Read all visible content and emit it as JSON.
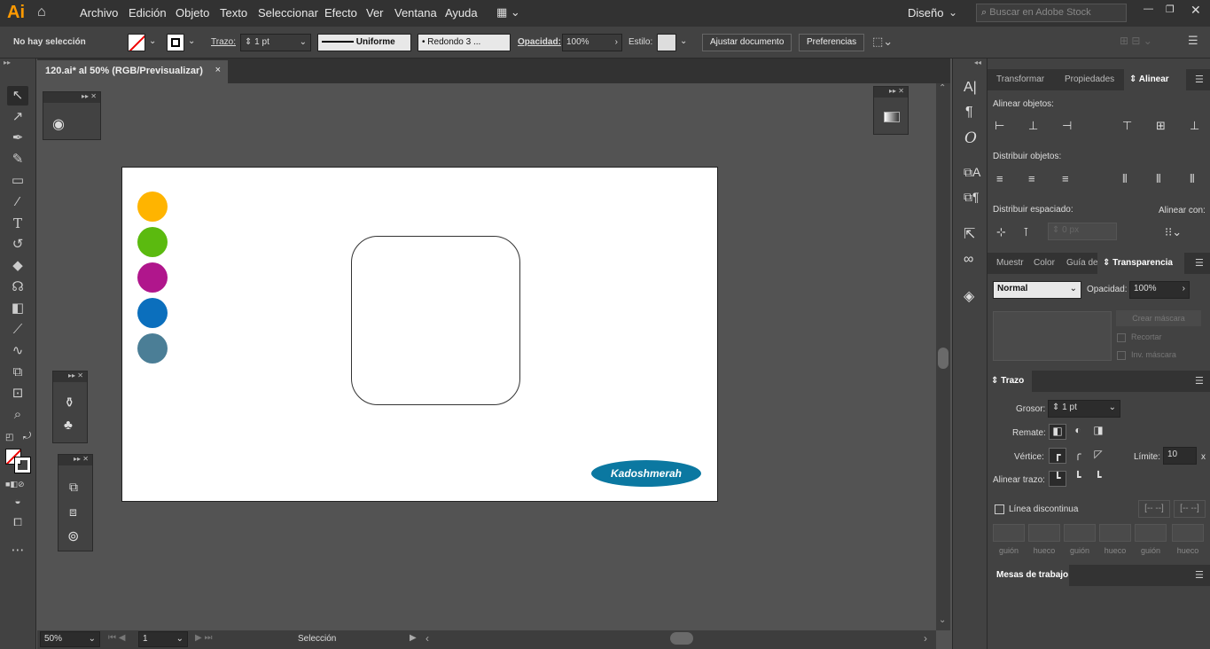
{
  "app": {
    "logo": "Ai",
    "workspace": "Diseño",
    "stock_search_placeholder": "Buscar en Adobe Stock"
  },
  "menu": [
    "Archivo",
    "Edición",
    "Objeto",
    "Texto",
    "Seleccionar",
    "Efecto",
    "Ver",
    "Ventana",
    "Ayuda"
  ],
  "control": {
    "selection": "No hay selección",
    "stroke_label": "Trazo:",
    "stroke_value": "1 pt",
    "profile": "Uniforme",
    "brush": "Redondo 3 ...",
    "opacity_label": "Opacidad:",
    "opacity_value": "100%",
    "style_label": "Estilo:",
    "adjust_doc": "Ajustar documento",
    "preferences": "Preferencias"
  },
  "document": {
    "tab": "120.ai* al 50% (RGB/Previsualizar)",
    "close": "×",
    "logo_text": "Kadoshmerah"
  },
  "swatches": [
    "#ffb400",
    "#5bba0f",
    "#b0168c",
    "#0b6fbd",
    "#4b7e96"
  ],
  "status": {
    "zoom": "50%",
    "page": "1",
    "tool": "Selección"
  },
  "align_panel": {
    "tabs": [
      "Transformar",
      "Propiedades",
      "Alinear"
    ],
    "align_objects": "Alinear objetos:",
    "distribute_objects": "Distribuir objetos:",
    "distribute_spacing": "Distribuir espaciado:",
    "align_to": "Alinear con:",
    "spacing_value": "0 px"
  },
  "transparency_panel": {
    "tabs": [
      "Muestr",
      "Color",
      "Guía de",
      "Transparencia"
    ],
    "blend_mode": "Normal",
    "opacity_label": "Opacidad:",
    "opacity_value": "100%",
    "make_mask": "Crear máscara",
    "clip": "Recortar",
    "invert_mask": "Inv. máscara"
  },
  "stroke_panel": {
    "title": "Trazo",
    "weight_label": "Grosor:",
    "weight_value": "1 pt",
    "cap_label": "Remate:",
    "corner_label": "Vértice:",
    "limit_label": "Límite:",
    "limit_value": "10",
    "limit_unit": "x",
    "align_label": "Alinear trazo:",
    "dashed_label": "Línea discontinua",
    "dash_labels": [
      "guión",
      "hueco",
      "guión",
      "hueco",
      "guión",
      "hueco"
    ]
  },
  "artboards_panel": {
    "title": "Mesas de trabajo"
  }
}
